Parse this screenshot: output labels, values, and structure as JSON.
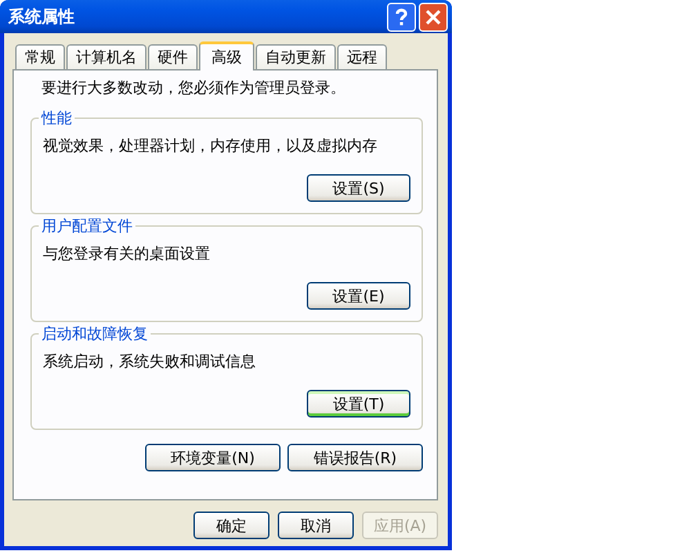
{
  "window": {
    "title": "系统属性"
  },
  "tabs": [
    {
      "label": "常规",
      "selected": false
    },
    {
      "label": "计算机名",
      "selected": false
    },
    {
      "label": "硬件",
      "selected": false
    },
    {
      "label": "高级",
      "selected": true
    },
    {
      "label": "自动更新",
      "selected": false
    },
    {
      "label": "远程",
      "selected": false
    }
  ],
  "notice": "要进行大多数改动，您必须作为管理员登录。",
  "groups": [
    {
      "title": "性能",
      "description": "视觉效果，处理器计划，内存使用，以及虚拟内存",
      "button": {
        "label": "设置(S)",
        "focused": false
      }
    },
    {
      "title": "用户配置文件",
      "description": "与您登录有关的桌面设置",
      "button": {
        "label": "设置(E)",
        "focused": false
      }
    },
    {
      "title": "启动和故障恢复",
      "description": "系统启动，系统失败和调试信息",
      "button": {
        "label": "设置(T)",
        "focused": true
      }
    }
  ],
  "extra_buttons": [
    {
      "label": "环境变量(N)"
    },
    {
      "label": "错误报告(R)"
    }
  ],
  "dialog_buttons": [
    {
      "label": "确定",
      "disabled": false
    },
    {
      "label": "取消",
      "disabled": false
    },
    {
      "label": "应用(A)",
      "disabled": true
    }
  ]
}
